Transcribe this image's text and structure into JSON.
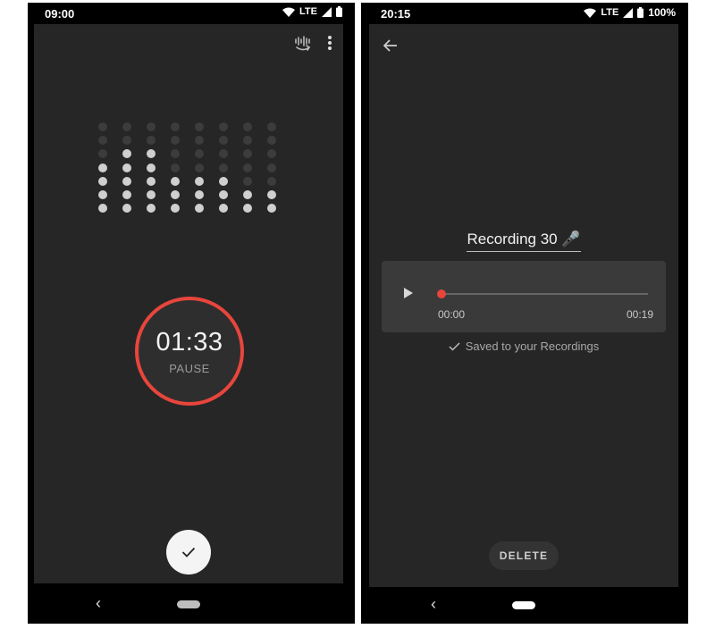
{
  "left_phone": {
    "status_time": "09:00",
    "status_network": "LTE",
    "top_icons": [
      "noise-reduction-icon",
      "more-vert-icon"
    ],
    "level_meter": {
      "columns": 8,
      "dots_per_column": 7,
      "lit_dots_per_column": [
        4,
        5,
        5,
        3,
        3,
        3,
        2,
        2
      ]
    },
    "timer": {
      "value": "01:33",
      "label": "PAUSE"
    },
    "done_icon": "check-icon",
    "nav": {
      "back_icon": "nav-back-icon",
      "home_icon": "nav-home-pill"
    }
  },
  "right_phone": {
    "status_time": "20:15",
    "status_network": "LTE",
    "battery_percent": "100%",
    "back_icon": "arrow-back-icon",
    "recording_title": "Recording 30 🎤",
    "player": {
      "play_icon": "play-icon",
      "current_time": "00:00",
      "total_time": "00:19",
      "progress": 0
    },
    "saved_message": "Saved to your Recordings",
    "delete_label": "DELETE",
    "nav": {
      "back_icon": "nav-back-icon",
      "home_icon": "nav-home-pill"
    }
  },
  "colors": {
    "screen_bg": "#262626",
    "accent_red": "#e8453c",
    "card_bg": "#3a3a3a",
    "dot_on": "#cfcfcf",
    "dot_off": "#3c3c3c"
  }
}
